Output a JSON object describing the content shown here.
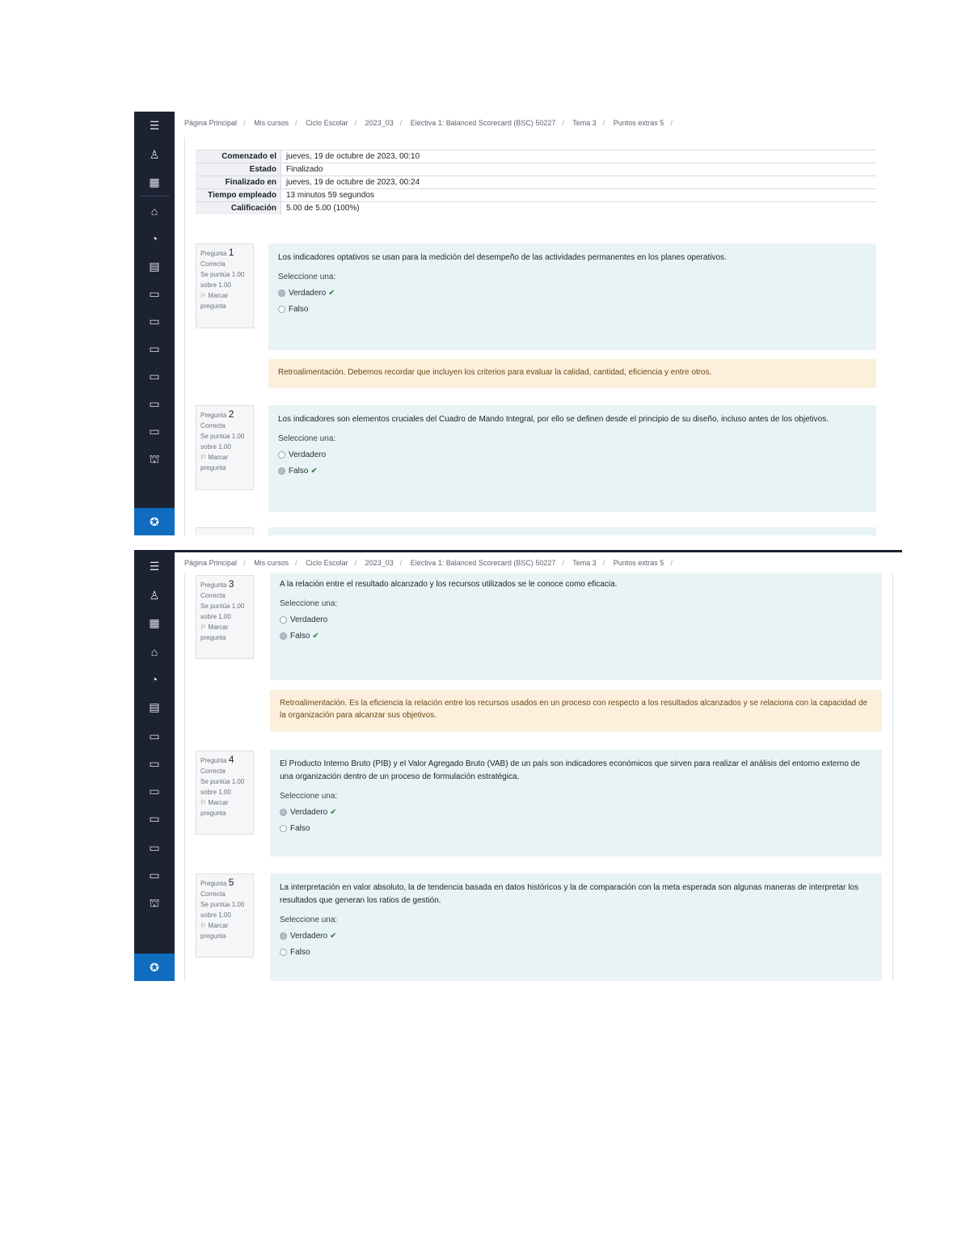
{
  "breadcrumb": [
    "Página Principal",
    "Mis cursos",
    "Ciclo Escolar",
    "2023_03",
    "Electiva 1: Balanced Scorecard (BSC) 50227",
    "Tema 3",
    "Puntos extras 5"
  ],
  "summary": [
    {
      "label": "Comenzado el",
      "value": "jueves, 19 de octubre de 2023, 00:10"
    },
    {
      "label": "Estado",
      "value": "Finalizado"
    },
    {
      "label": "Finalizado en",
      "value": "jueves, 19 de octubre de 2023, 00:24"
    },
    {
      "label": "Tiempo empleado",
      "value": "13 minutos 59 segundos"
    },
    {
      "label": "Calificación",
      "value": "5.00 de 5.00 (100%)"
    }
  ],
  "select_label": "Seleccione una:",
  "info": {
    "question": "Pregunta",
    "status": "Correcta",
    "score": "Se puntúa 1.00 sobre 1.00",
    "flag": "Marcar pregunta"
  },
  "questions": [
    {
      "number": "1",
      "text": "Los indicadores optativos se usan para la medición del desempeño de las actividades permanentes en los planes operativos.",
      "options": [
        "Verdadero",
        "Falso"
      ],
      "feedback": "Retroalimentación. Debemos recordar que incluyen los criterios para evaluar la calidad, cantidad, eficiencia y entre otros."
    },
    {
      "number": "2",
      "text": "Los indicadores son elementos cruciales del Cuadro de Mando Integral, por ello se definen desde el principio de su diseño, incluso antes de los objetivos.",
      "options": [
        "Verdadero",
        "Falso"
      ]
    },
    {
      "number": "3",
      "text": "A la relación entre el resultado alcanzado y los recursos utilizados se le conoce como eficacia.",
      "options": [
        "Verdadero",
        "Falso"
      ],
      "feedback": "Retroalimentación. Es la eficiencia la relación entre los recursos usados en un proceso con respecto a los resultados alcanzados y se relaciona con la capacidad de la organización para alcanzar sus objetivos."
    },
    {
      "number": "4",
      "text": "El Producto Interno Bruto (PIB) y el Valor Agregado Bruto (VAB) de un país son indicadores económicos que sirven para realizar el análisis del entorno externo de una organización dentro de un proceso de formulación estratégica.",
      "options": [
        "Verdadero",
        "Falso"
      ]
    },
    {
      "number": "5",
      "text": "La interpretación en valor absoluto, la de tendencia basada en datos históricos y la de comparación con la meta esperada son algunas maneras de interpretar los resultados que generan los ratios de gestión.",
      "options": [
        "Verdadero",
        "Falso"
      ]
    }
  ]
}
